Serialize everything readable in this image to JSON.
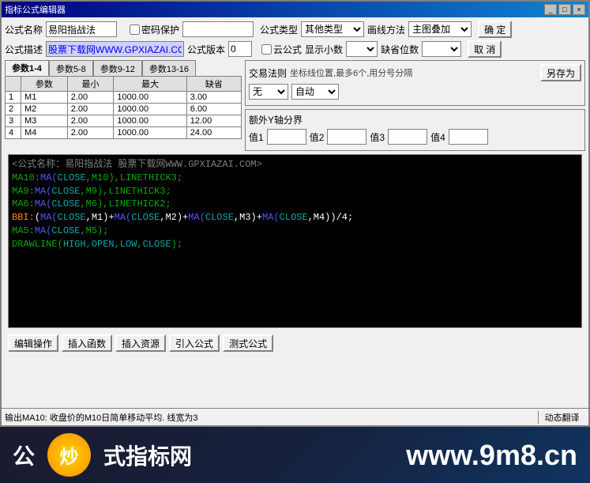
{
  "window": {
    "title": "指标公式编辑器",
    "title_buttons": [
      "_",
      "□",
      "×"
    ]
  },
  "form": {
    "formula_name_label": "公式名称",
    "formula_name_value": "易阳指战法",
    "password_label": "密码保护",
    "password_value": "",
    "formula_type_label": "公式类型",
    "formula_type_value": "其他类型",
    "draw_method_label": "画线方法",
    "draw_method_value": "主图叠加",
    "confirm_label": "确  定",
    "cancel_label": "取  消",
    "formula_desc_label": "公式描述",
    "formula_desc_value": "股票下载网WWW.GPXIAZAI.COM",
    "formula_version_label": "公式版本",
    "formula_version_value": "0",
    "cloud_formula_label": "云公式",
    "show_decimal_label": "显示小数",
    "default_digits_label": "缺省位数",
    "save_as_label": "另存为"
  },
  "tabs": [
    {
      "label": "参数1-4",
      "active": true
    },
    {
      "label": "参数5-8",
      "active": false
    },
    {
      "label": "参数9-12",
      "active": false
    },
    {
      "label": "参数13-16",
      "active": false
    }
  ],
  "param_table": {
    "headers": [
      "",
      "参数",
      "最小",
      "最大",
      "缺省"
    ],
    "rows": [
      {
        "index": "1",
        "param": "M1",
        "min": "2.00",
        "max": "1000.00",
        "default": "3.00"
      },
      {
        "index": "2",
        "param": "M2",
        "min": "2.00",
        "max": "1000.00",
        "default": "6.00"
      },
      {
        "index": "3",
        "param": "M3",
        "min": "2.00",
        "max": "1000.00",
        "default": "12.00"
      },
      {
        "index": "4",
        "param": "M4",
        "min": "2.00",
        "max": "1000.00",
        "default": "24.00"
      }
    ]
  },
  "trade_rule": {
    "title": "交易法则",
    "subtitle": "坐标线位置,最多6个,用分号分隔",
    "option1_label": "无",
    "option2_label": "自动"
  },
  "y_boundary": {
    "title": "额外Y轴分界",
    "value1_label": "值1",
    "value1": "",
    "value2_label": "值2",
    "value2": "",
    "value3_label": "值3",
    "value3": "",
    "value4_label": "值4",
    "value4": ""
  },
  "code": {
    "comment_line": "<公式名称：易阳指战法 股票下载网WWW.GPXIAZAI.COM>",
    "lines": [
      {
        "text": "MA10:MA(CLOSE,M10),LINETHICK3;",
        "color": "green"
      },
      {
        "text": "MA9:MA(CLOSE,M9),LINETHICK3;",
        "color": "green"
      },
      {
        "text": "MA6:MA(CLOSE,M6),LINETHICK2;",
        "color": "green"
      },
      {
        "text": "BBI:(MA(CLOSE,M1)+MA(CLOSE,M2)+MA(CLOSE,M3)+MA(CLOSE,M4))/4;",
        "color": "mixed"
      },
      {
        "text": "MA5:MA(CLOSE,M5);",
        "color": "green"
      },
      {
        "text": "DRAWLINE(HIGH,OPEN,LOW,CLOSE);",
        "color": "green"
      }
    ]
  },
  "bottom_toolbar": {
    "edit_ops_label": "编辑操作",
    "insert_func_label": "插入函数",
    "insert_resource_label": "插入资源",
    "import_formula_label": "引入公式",
    "test_formula_label": "测式公式"
  },
  "status": {
    "text": "输出MA10: 收盘价的M10日简单移动平均. 线宽为3",
    "dynamic_translate": "动态翻译"
  },
  "watermark": {
    "left_text": "式指标网",
    "right_text": "www.9m8.cn",
    "logo_text": "炒"
  }
}
